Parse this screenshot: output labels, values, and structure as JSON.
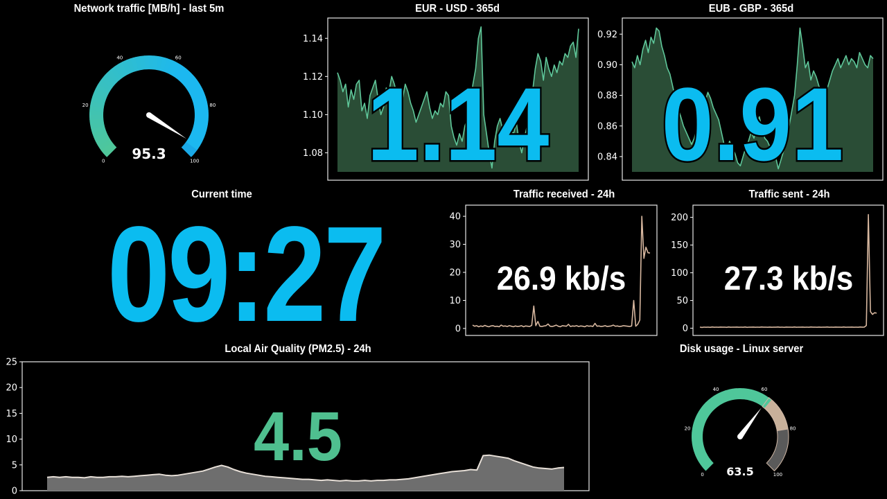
{
  "gauges": {
    "network": {
      "title": "Network traffic [MB/h] - last 5m",
      "value_text": "95.3",
      "value": 95.3,
      "min": 0,
      "max": 100,
      "ticks": [
        "0",
        "20",
        "40",
        "60",
        "80",
        "100"
      ],
      "colors": {
        "start": "#4fc79a",
        "end": "#1cb8f0",
        "highlight": "#1aa9e8"
      }
    },
    "disk": {
      "title": "Disk usage - Linux server",
      "value_text": "63.5",
      "value": 63.5,
      "min": 0,
      "max": 100,
      "ticks": [
        "0",
        "20",
        "40",
        "60",
        "80",
        "100"
      ],
      "colors": {
        "used": "#4fc79a",
        "mid": "#c8b09a",
        "rest": "#5a5a5a"
      }
    }
  },
  "clock": {
    "title": "Current time",
    "time": "09:27"
  },
  "chart_data": [
    {
      "id": "eur-usd",
      "type": "area",
      "title": "EUR - USD - 365d",
      "big_value": "1.14",
      "yticks": [
        "1.08",
        "1.10",
        "1.12",
        "1.14"
      ],
      "ylim": [
        1.07,
        1.147
      ],
      "color": "#5fc79a",
      "fill": "#2a4d36",
      "values": [
        1.122,
        1.118,
        1.112,
        1.116,
        1.104,
        1.113,
        1.108,
        1.116,
        1.118,
        1.102,
        1.106,
        1.098,
        1.11,
        1.114,
        1.118,
        1.108,
        1.1,
        1.104,
        1.114,
        1.112,
        1.12,
        1.116,
        1.11,
        1.104,
        1.108,
        1.116,
        1.112,
        1.106,
        1.102,
        1.096,
        1.1,
        1.104,
        1.108,
        1.112,
        1.104,
        1.098,
        1.102,
        1.1,
        1.106,
        1.104,
        1.112,
        1.11,
        1.094,
        1.088,
        1.084,
        1.09,
        1.086,
        1.094,
        1.098,
        1.106,
        1.116,
        1.124,
        1.14,
        1.146,
        1.1,
        1.09,
        1.08,
        1.072,
        1.086,
        1.094,
        1.098,
        1.092,
        1.088,
        1.084,
        1.092,
        1.09,
        1.096,
        1.086,
        1.08,
        1.088,
        1.094,
        1.102,
        1.112,
        1.124,
        1.132,
        1.128,
        1.118,
        1.13,
        1.124,
        1.12,
        1.126,
        1.122,
        1.128,
        1.126,
        1.132,
        1.13,
        1.136,
        1.138,
        1.13,
        1.145
      ]
    },
    {
      "id": "eub-gbp",
      "type": "area",
      "title": "EUB - GBP - 365d",
      "big_value": "0.91",
      "yticks": [
        "0.84",
        "0.86",
        "0.88",
        "0.90",
        "0.92"
      ],
      "ylim": [
        0.83,
        0.926
      ],
      "color": "#5fc79a",
      "fill": "#2a4d36",
      "values": [
        0.902,
        0.898,
        0.906,
        0.9,
        0.91,
        0.916,
        0.908,
        0.918,
        0.914,
        0.924,
        0.922,
        0.912,
        0.906,
        0.898,
        0.894,
        0.886,
        0.878,
        0.872,
        0.866,
        0.86,
        0.856,
        0.852,
        0.848,
        0.852,
        0.858,
        0.862,
        0.868,
        0.876,
        0.882,
        0.878,
        0.872,
        0.868,
        0.864,
        0.856,
        0.848,
        0.844,
        0.85,
        0.846,
        0.842,
        0.836,
        0.834,
        0.84,
        0.846,
        0.85,
        0.856,
        0.852,
        0.86,
        0.866,
        0.858,
        0.852,
        0.85,
        0.846,
        0.844,
        0.84,
        0.832,
        0.838,
        0.844,
        0.852,
        0.86,
        0.87,
        0.88,
        0.9,
        0.924,
        0.912,
        0.898,
        0.902,
        0.89,
        0.896,
        0.892,
        0.886,
        0.882,
        0.878,
        0.884,
        0.89,
        0.896,
        0.9,
        0.904,
        0.898,
        0.902,
        0.906,
        0.9,
        0.904,
        0.902,
        0.898,
        0.908,
        0.904,
        0.9,
        0.898,
        0.906,
        0.904
      ]
    },
    {
      "id": "traffic-received",
      "type": "line",
      "title": "Traffic received - 24h",
      "big_value": "26.9 kb/s",
      "yticks": [
        "0",
        "10",
        "20",
        "30",
        "40"
      ],
      "ylim": [
        -1.5,
        42
      ],
      "color": "#d8b8a0",
      "values": [
        1.2,
        0.8,
        1.0,
        0.6,
        0.9,
        0.7,
        1.1,
        0.8,
        0.6,
        0.9,
        1.0,
        0.7,
        0.8,
        0.6,
        1.2,
        0.8,
        0.9,
        0.7,
        1.0,
        0.8,
        0.6,
        0.9,
        0.7,
        0.8,
        1.0,
        0.6,
        0.9,
        0.8,
        0.7,
        1.1,
        8.0,
        1.0,
        2.5,
        0.8,
        0.7,
        0.9,
        1.0,
        1.6,
        0.8,
        0.7,
        0.9,
        1.2,
        0.8,
        0.6,
        1.0,
        0.9,
        0.8,
        1.5,
        0.7,
        0.9,
        0.8,
        1.0,
        0.7,
        0.9,
        0.8,
        0.6,
        1.0,
        0.8,
        0.9,
        0.7,
        1.8,
        0.8,
        0.9,
        0.7,
        0.8,
        1.0,
        0.7,
        0.8,
        0.9,
        1.2,
        0.8,
        0.9,
        0.7,
        0.8,
        1.0,
        0.9,
        0.8,
        0.7,
        0.9,
        10.0,
        0.8,
        1.5,
        3.0,
        40.0,
        25.0,
        29.0,
        27.0,
        26.9
      ]
    },
    {
      "id": "traffic-sent",
      "type": "line",
      "title": "Traffic sent - 24h",
      "big_value": "27.3 kb/s",
      "yticks": [
        "0",
        "50",
        "100",
        "150",
        "200"
      ],
      "ylim": [
        -8,
        212
      ],
      "color": "#d8b8a0",
      "values": [
        2,
        1.5,
        2,
        1.8,
        2,
        1.6,
        2.2,
        1.8,
        2,
        1.7,
        2.1,
        1.9,
        2,
        1.6,
        2.2,
        1.8,
        2,
        1.9,
        2.1,
        1.7,
        2,
        1.8,
        2.2,
        1.6,
        2,
        1.9,
        2.1,
        1.8,
        2,
        1.7,
        2.3,
        1.9,
        2,
        1.8,
        2.1,
        1.7,
        2,
        1.9,
        2.2,
        1.8,
        2,
        1.6,
        2.1,
        1.9,
        2,
        1.8,
        2.2,
        1.7,
        2,
        1.9,
        2.1,
        1.8,
        2,
        1.7,
        2.2,
        1.9,
        2,
        1.8,
        2.1,
        1.7,
        2,
        1.9,
        2.2,
        1.8,
        2,
        1.7,
        2.1,
        1.9,
        2,
        1.8,
        2.2,
        1.7,
        2,
        1.9,
        2.1,
        1.8,
        2,
        1.7,
        2.3,
        1.9,
        2,
        5,
        205,
        30,
        25,
        28,
        27.3
      ]
    },
    {
      "id": "air-quality",
      "type": "area",
      "title": "Local Air Quality (PM2.5) - 24h",
      "big_value": "4.5",
      "yticks": [
        "0",
        "5",
        "10",
        "15",
        "20",
        "25"
      ],
      "ylim": [
        0,
        25
      ],
      "color": "#e8e0d8",
      "fill": "#6e6e6e",
      "values": [
        2.6,
        2.7,
        2.6,
        2.7,
        2.6,
        2.6,
        2.5,
        2.7,
        2.6,
        2.6,
        2.7,
        2.7,
        2.8,
        2.7,
        2.8,
        2.9,
        3.0,
        3.1,
        3.2,
        3.0,
        2.9,
        3.0,
        3.2,
        3.4,
        3.6,
        3.8,
        4.2,
        4.6,
        4.9,
        4.6,
        4.1,
        3.7,
        3.4,
        3.2,
        3.0,
        2.8,
        2.7,
        2.6,
        2.5,
        2.4,
        2.3,
        2.2,
        2.2,
        2.1,
        2.0,
        2.1,
        2.0,
        1.9,
        2.0,
        1.9,
        1.9,
        2.0,
        1.9,
        2.0,
        2.0,
        2.1,
        2.1,
        2.2,
        2.3,
        2.5,
        2.7,
        2.9,
        3.1,
        3.3,
        3.5,
        3.7,
        3.8,
        3.9,
        4.1,
        4.0,
        6.8,
        6.9,
        6.7,
        6.5,
        6.3,
        5.8,
        5.4,
        5.0,
        4.6,
        4.4,
        4.3,
        4.2,
        4.4,
        4.5
      ]
    }
  ]
}
